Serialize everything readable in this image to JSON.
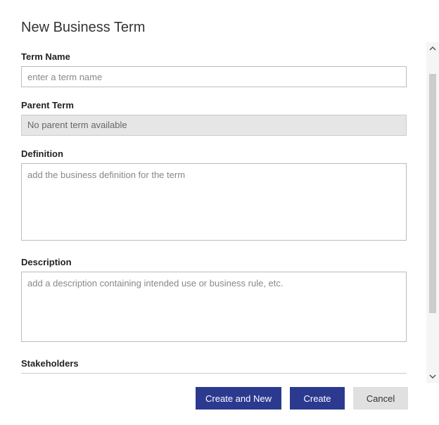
{
  "page": {
    "title": "New Business Term"
  },
  "fields": {
    "term_name": {
      "label": "Term Name",
      "placeholder": "enter a term name",
      "value": ""
    },
    "parent_term": {
      "label": "Parent Term",
      "value": "No parent term available"
    },
    "definition": {
      "label": "Definition",
      "placeholder": "add the business definition for the term",
      "value": ""
    },
    "description": {
      "label": "Description",
      "placeholder": "add a description containing intended use or business rule, etc.",
      "value": ""
    },
    "stakeholders": {
      "label": "Stakeholders"
    }
  },
  "buttons": {
    "create_and_new": "Create and New",
    "create": "Create",
    "cancel": "Cancel"
  }
}
